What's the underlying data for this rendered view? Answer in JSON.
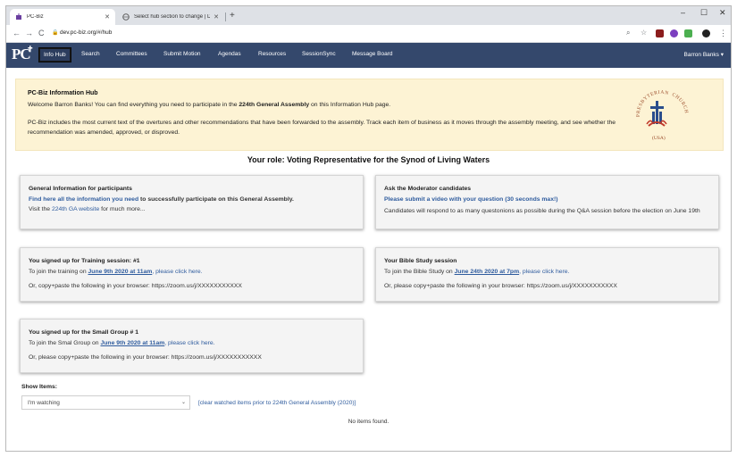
{
  "browser": {
    "tabs": [
      {
        "title": "PC-Biz",
        "active": true
      },
      {
        "title": "Select hub section to change | D...",
        "active": false
      }
    ],
    "url": "dev.pc-biz.org/#/hub"
  },
  "nav": {
    "logo": "PC",
    "items": [
      "Info Hub",
      "Search",
      "Committees",
      "Submit Motion",
      "Agendas",
      "Resources",
      "SessionSync",
      "Message Board"
    ],
    "user": "Barron Banks"
  },
  "info": {
    "title": "PC-Biz Information Hub",
    "welcome_prefix": "Welcome Barron Banks! You can find everything you need to participate in the ",
    "welcome_bold": "224th General Assembly",
    "welcome_suffix": " on this Information Hub page.",
    "desc": "PC-Biz includes the most current text of the overtures and other recommendations that have been forwarded to the assembly. Track each item of business as it moves through the assembly meeting, and see whether the recommendation was amended, approved, or disproved.",
    "seal_top": "PRESBYTERIAN",
    "seal_right": "CHURCH",
    "seal_bottom": "(USA)"
  },
  "role": "Your role: Voting Representative for the Synod of Living Waters",
  "cards": {
    "general": {
      "title": "General Information for participants",
      "link_text": "Find here all the information you need",
      "link_suffix": " to successfully participate on this General Assembly.",
      "visit_prefix": "Visit the ",
      "visit_link": "224th GA website",
      "visit_suffix": " for much more..."
    },
    "moderator": {
      "title": "Ask the Moderator candidates",
      "link_text": "Please submit a video with your question (30 seconds max!)",
      "body": "Candidates will respond to as many questonions as possible during the Q&A session before the election on June 19th"
    },
    "training": {
      "title": "You signed up for Training session: #1",
      "join_prefix": "To join the training on ",
      "date": "June 9th 2020 at 11am",
      "click": ", please click here.",
      "copy": "Or, copy+paste the following in your browser: https://zoom.us/j/XXXXXXXXXXX"
    },
    "bible": {
      "title": "Your Bible Study session",
      "join_prefix": "To join the Bible Study on ",
      "date": "June 24th 2020 at 7pm",
      "click": ", please click here.",
      "copy": "Or, please copy+paste the following in your browser: https://zoom.us/j/XXXXXXXXXXX"
    },
    "small_group": {
      "title": "You signed up for the Small Group # 1",
      "join_prefix": "To join the Smal Group on ",
      "date": "June 9th 2020 at 11am",
      "click": ", please click here.",
      "copy": "Or, please copy+paste the following in your browser: https://zoom.us/j/XXXXXXXXXXX"
    }
  },
  "show_items": {
    "label": "Show Items:",
    "selected": "I'm watching",
    "clear_link": "[clear watched items prior to 224th General Assembly (2020)]",
    "empty": "No items found."
  }
}
